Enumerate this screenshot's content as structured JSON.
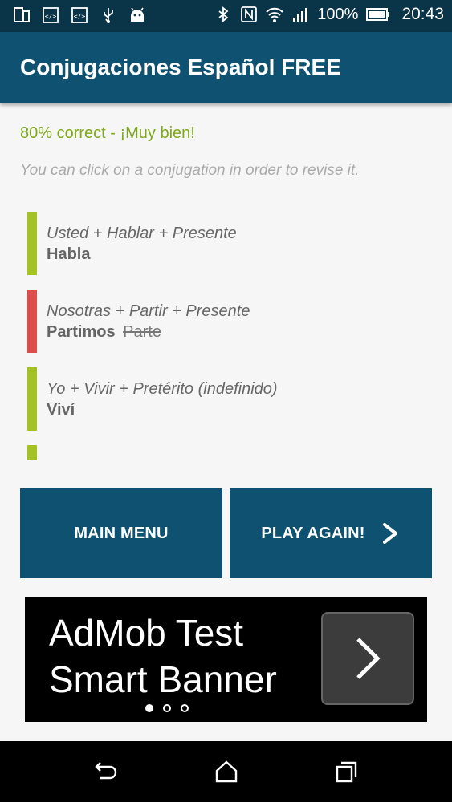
{
  "status_bar": {
    "left_icons": [
      "tablet-icon",
      "code-icon",
      "code-icon",
      "usb-icon",
      "android-icon"
    ],
    "right_icons": [
      "bluetooth-icon",
      "nfc-icon",
      "wifi-icon",
      "signal-icon",
      "battery-icon"
    ],
    "battery": "100%",
    "time": "20:43"
  },
  "app_bar": {
    "title": "Conjugaciones Español FREE"
  },
  "score": "80% correct - ¡Muy bien!",
  "hint": "You can click on a conjugation in order to revise it.",
  "colors": {
    "correct": "#a4c226",
    "incorrect": "#dd4b4b",
    "primary": "#0e5170",
    "score_text": "#7ea71a"
  },
  "results": [
    {
      "question": "Usted + Hablar + Presente",
      "answer": "Habla",
      "wrong": "",
      "status": "correct"
    },
    {
      "question": "Nosotras + Partir + Presente",
      "answer": "Partimos",
      "wrong": "Parte",
      "status": "incorrect"
    },
    {
      "question": "Yo + Vivir + Pretérito (indefinido)",
      "answer": "Viví",
      "wrong": "",
      "status": "correct"
    },
    {
      "question": "",
      "answer": "",
      "wrong": "",
      "status": "correct"
    }
  ],
  "buttons": {
    "main_menu": "MAIN MENU",
    "play_again": "PLAY AGAIN!"
  },
  "ad": {
    "line1": "AdMob Test",
    "line2": "Smart Banner"
  },
  "nav_bar": {
    "icons": [
      "back-icon",
      "home-icon",
      "recents-icon"
    ]
  }
}
